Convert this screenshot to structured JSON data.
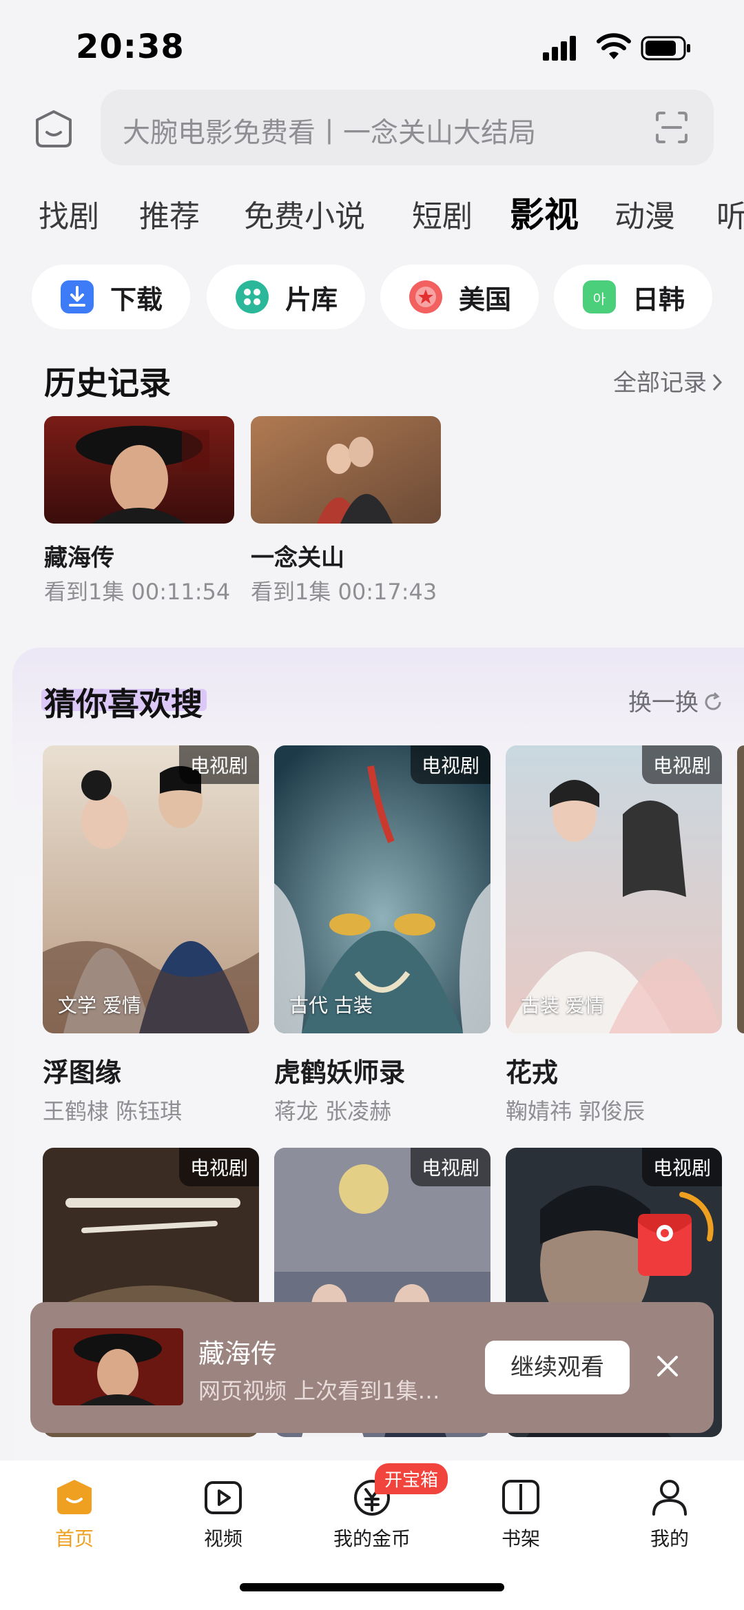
{
  "status_bar": {
    "time": "20:38"
  },
  "search": {
    "placeholder": "大腕电影免费看丨一念关山大结局"
  },
  "tabs": [
    "找剧",
    "推荐",
    "免费小说",
    "短剧",
    "影视",
    "动漫",
    "听"
  ],
  "active_tab": "影视",
  "chips": [
    {
      "label": "下载",
      "icon": "download-icon"
    },
    {
      "label": "片库",
      "icon": "library-icon"
    },
    {
      "label": "美国",
      "icon": "usa-icon"
    },
    {
      "label": "日韩",
      "icon": "tv-icon"
    }
  ],
  "history": {
    "title": "历史记录",
    "link": "全部记录",
    "items": [
      {
        "title": "藏海传",
        "progress": "看到1集 00:11:54"
      },
      {
        "title": "一念关山",
        "progress": "看到1集 00:17:43"
      }
    ]
  },
  "recommend": {
    "title": "猜你喜欢搜",
    "refresh": "换一换",
    "cards": [
      {
        "badge": "电视剧",
        "tags": "文学 爱情",
        "title": "浮图缘",
        "cast": "王鹤棣 陈钰琪"
      },
      {
        "badge": "电视剧",
        "tags": "古代 古装",
        "title": "虎鹤妖师录",
        "cast": "蒋龙 张凌赫"
      },
      {
        "badge": "电视剧",
        "tags": "古装 爱情",
        "title": "花戎",
        "cast": "鞠婧祎 郭俊辰"
      }
    ],
    "row2": [
      {
        "badge": "电视剧"
      },
      {
        "badge": "电视剧"
      },
      {
        "badge": "电视剧"
      }
    ]
  },
  "banner": {
    "title": "藏海传",
    "subtitle": "网页视频 上次看到1集…",
    "button": "继续观看"
  },
  "bottom_nav": [
    {
      "label": "首页",
      "icon": "home-icon",
      "active": true
    },
    {
      "label": "视频",
      "icon": "video-icon"
    },
    {
      "label": "我的金币",
      "icon": "coin-icon",
      "badge": "开宝箱"
    },
    {
      "label": "书架",
      "icon": "bookshelf-icon"
    },
    {
      "label": "我的",
      "icon": "profile-icon"
    }
  ],
  "colors": {
    "accent": "#f0a020",
    "banner_bg": "#9c8581",
    "badge_red": "#f0443c",
    "highlight": "#dcc8f7"
  }
}
